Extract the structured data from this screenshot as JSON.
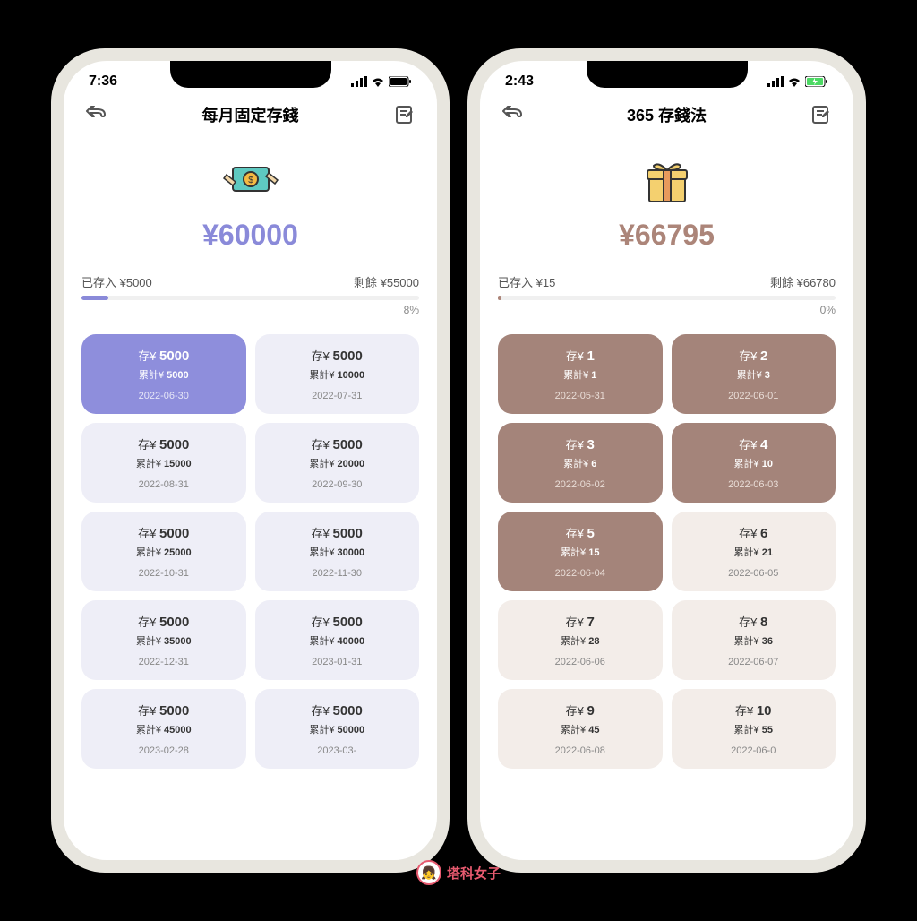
{
  "phone1": {
    "statusTime": "7:36",
    "navTitle": "每月固定存錢",
    "goalAmount": "¥60000",
    "savedLabel": "已存入 ¥5000",
    "remainLabel": "剩餘 ¥55000",
    "progressPct": "8%",
    "progressWidth": "8%",
    "cards": [
      {
        "deposit": "存¥ 5000",
        "depositVal": "5000",
        "cumLabel": "累計¥ 5000",
        "cumVal": "5000",
        "date": "2022-06-30",
        "active": true
      },
      {
        "deposit": "存¥ 5000",
        "depositVal": "5000",
        "cumLabel": "累計¥ 10000",
        "cumVal": "10000",
        "date": "2022-07-31",
        "active": false
      },
      {
        "deposit": "存¥ 5000",
        "depositVal": "5000",
        "cumLabel": "累計¥ 15000",
        "cumVal": "15000",
        "date": "2022-08-31",
        "active": false
      },
      {
        "deposit": "存¥ 5000",
        "depositVal": "5000",
        "cumLabel": "累計¥ 20000",
        "cumVal": "20000",
        "date": "2022-09-30",
        "active": false
      },
      {
        "deposit": "存¥ 5000",
        "depositVal": "5000",
        "cumLabel": "累計¥ 25000",
        "cumVal": "25000",
        "date": "2022-10-31",
        "active": false
      },
      {
        "deposit": "存¥ 5000",
        "depositVal": "5000",
        "cumLabel": "累計¥ 30000",
        "cumVal": "30000",
        "date": "2022-11-30",
        "active": false
      },
      {
        "deposit": "存¥ 5000",
        "depositVal": "5000",
        "cumLabel": "累計¥ 35000",
        "cumVal": "35000",
        "date": "2022-12-31",
        "active": false
      },
      {
        "deposit": "存¥ 5000",
        "depositVal": "5000",
        "cumLabel": "累計¥ 40000",
        "cumVal": "40000",
        "date": "2023-01-31",
        "active": false
      },
      {
        "deposit": "存¥ 5000",
        "depositVal": "5000",
        "cumLabel": "累計¥ 45000",
        "cumVal": "45000",
        "date": "2023-02-28",
        "active": false
      },
      {
        "deposit": "存¥ 5000",
        "depositVal": "5000",
        "cumLabel": "累計¥ 50000",
        "cumVal": "50000",
        "date": "2023-03-",
        "active": false
      }
    ]
  },
  "phone2": {
    "statusTime": "2:43",
    "navTitle": "365 存錢法",
    "goalAmount": "¥66795",
    "savedLabel": "已存入 ¥15",
    "remainLabel": "剩餘 ¥66780",
    "progressPct": "0%",
    "progressWidth": "1%",
    "cards": [
      {
        "deposit": "存¥ 1",
        "depositVal": "1",
        "cumLabel": "累計¥ 1",
        "cumVal": "1",
        "date": "2022-05-31",
        "active": true
      },
      {
        "deposit": "存¥ 2",
        "depositVal": "2",
        "cumLabel": "累計¥ 3",
        "cumVal": "3",
        "date": "2022-06-01",
        "active": true
      },
      {
        "deposit": "存¥ 3",
        "depositVal": "3",
        "cumLabel": "累計¥ 6",
        "cumVal": "6",
        "date": "2022-06-02",
        "active": true
      },
      {
        "deposit": "存¥ 4",
        "depositVal": "4",
        "cumLabel": "累計¥ 10",
        "cumVal": "10",
        "date": "2022-06-03",
        "active": true
      },
      {
        "deposit": "存¥ 5",
        "depositVal": "5",
        "cumLabel": "累計¥ 15",
        "cumVal": "15",
        "date": "2022-06-04",
        "active": true
      },
      {
        "deposit": "存¥ 6",
        "depositVal": "6",
        "cumLabel": "累計¥ 21",
        "cumVal": "21",
        "date": "2022-06-05",
        "active": false
      },
      {
        "deposit": "存¥ 7",
        "depositVal": "7",
        "cumLabel": "累計¥ 28",
        "cumVal": "28",
        "date": "2022-06-06",
        "active": false
      },
      {
        "deposit": "存¥ 8",
        "depositVal": "8",
        "cumLabel": "累計¥ 36",
        "cumVal": "36",
        "date": "2022-06-07",
        "active": false
      },
      {
        "deposit": "存¥ 9",
        "depositVal": "9",
        "cumLabel": "累計¥ 45",
        "cumVal": "45",
        "date": "2022-06-08",
        "active": false
      },
      {
        "deposit": "存¥ 10",
        "depositVal": "10",
        "cumLabel": "累計¥ 55",
        "cumVal": "55",
        "date": "2022-06-0",
        "active": false
      }
    ]
  },
  "watermark": "塔科女子",
  "labels": {
    "depositPrefix": "存¥ ",
    "cumPrefix": "累計¥ "
  }
}
